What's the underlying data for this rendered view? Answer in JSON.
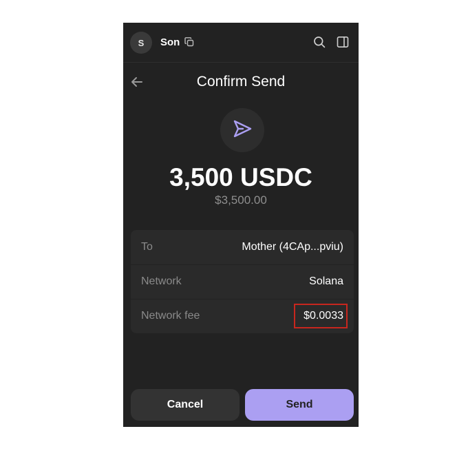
{
  "header": {
    "avatar_initial": "S",
    "account_name": "Son",
    "icons": [
      "copy-icon",
      "search-icon",
      "sidebar-panel-icon"
    ]
  },
  "title": "Confirm Send",
  "send_icon": "send-arrow-icon",
  "amount": "3,500 USDC",
  "fiat_value": "$3,500.00",
  "details": [
    {
      "label": "To",
      "value": "Mother (4CAp...pviu)"
    },
    {
      "label": "Network",
      "value": "Solana"
    },
    {
      "label": "Network fee",
      "value": "$0.0033"
    }
  ],
  "buttons": {
    "cancel": "Cancel",
    "send": "Send"
  },
  "colors": {
    "background": "#222222",
    "accent": "#ab9ff2",
    "highlight_border": "#c8261e"
  }
}
